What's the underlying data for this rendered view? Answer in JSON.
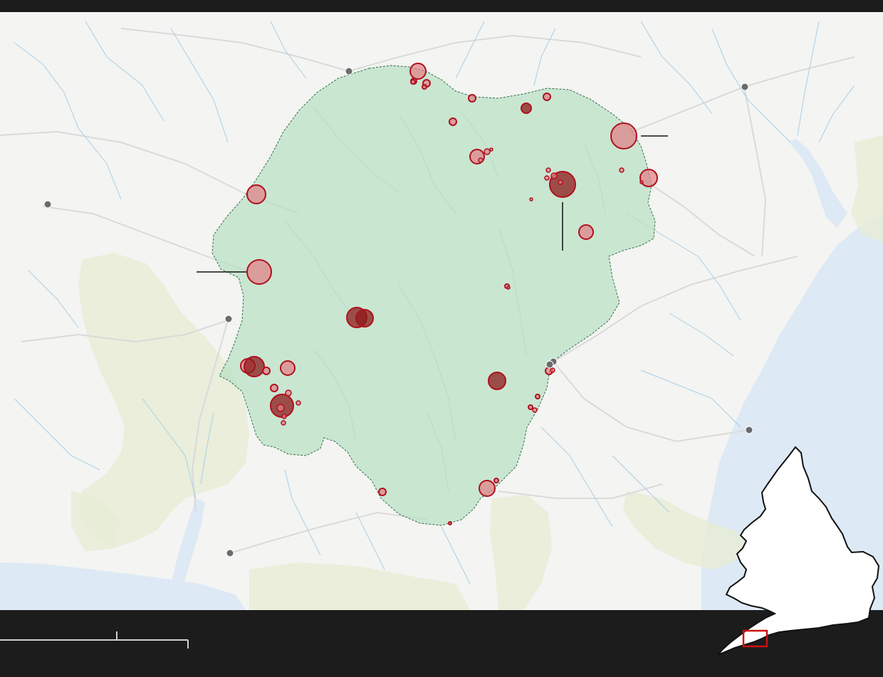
{
  "map": {
    "colors": {
      "land": "#f4f4f2",
      "sea": "#dde9f4",
      "river": "#a8cfe6",
      "road": "#dadada",
      "national_park_fill": "#b9e0c4",
      "national_park_border": "#2f6e4a",
      "aonb_fill": "#e8ecd7",
      "marker_fill_dark": "#8c1a1a",
      "marker_fill_light": "#e37e86",
      "marker_stroke": "#b0101e",
      "town_dot": "#6b6b6b",
      "frame": "#1c1c1c",
      "scale_bar": "#d0d0d0",
      "locator_land": "#ffffff",
      "locator_frame": "#cc1111"
    },
    "icons": {
      "town": "town-dot-icon",
      "site": "site-circle-marker-icon",
      "locator": "england-wales-locator-icon"
    },
    "sites": [
      {
        "id": "s01",
        "tone": "light",
        "magnitude": 3
      },
      {
        "id": "s02",
        "tone": "light",
        "magnitude": 2
      },
      {
        "id": "s03",
        "tone": "light",
        "magnitude": 1
      },
      {
        "id": "s04",
        "tone": "light",
        "magnitude": 1
      },
      {
        "id": "s05",
        "tone": "light",
        "magnitude": 1
      },
      {
        "id": "s06",
        "tone": "light",
        "magnitude": 3
      },
      {
        "id": "s07",
        "tone": "light",
        "magnitude": 2
      },
      {
        "id": "s08",
        "tone": "dark",
        "magnitude": 4
      },
      {
        "id": "s09",
        "tone": "light",
        "magnitude": 2
      },
      {
        "id": "s10",
        "tone": "light",
        "magnitude": 8
      },
      {
        "id": "s11",
        "tone": "light",
        "magnitude": 5
      },
      {
        "id": "s12",
        "tone": "dark",
        "magnitude": 9
      },
      {
        "id": "s13",
        "tone": "light",
        "magnitude": 4
      },
      {
        "id": "s14",
        "tone": "light",
        "magnitude": 5
      },
      {
        "id": "s15",
        "tone": "light",
        "magnitude": 8
      },
      {
        "id": "s16",
        "tone": "dark",
        "magnitude": 7
      },
      {
        "id": "s17",
        "tone": "dark",
        "magnitude": 6
      },
      {
        "id": "s18",
        "tone": "light",
        "magnitude": 5
      },
      {
        "id": "s19",
        "tone": "light",
        "magnitude": 5
      },
      {
        "id": "s20",
        "tone": "light",
        "magnitude": 4
      },
      {
        "id": "s21",
        "tone": "light",
        "magnitude": 2
      },
      {
        "id": "s22",
        "tone": "dark",
        "magnitude": 7
      },
      {
        "id": "s23",
        "tone": "dark",
        "magnitude": 6
      },
      {
        "id": "s24",
        "tone": "light",
        "magnitude": 2
      },
      {
        "id": "s25",
        "tone": "dark",
        "magnitude": 6
      },
      {
        "id": "s26",
        "tone": "light",
        "magnitude": 2
      },
      {
        "id": "s27",
        "tone": "light",
        "magnitude": 2
      },
      {
        "id": "s28",
        "tone": "light",
        "magnitude": 1
      },
      {
        "id": "s29",
        "tone": "light",
        "magnitude": 1
      },
      {
        "id": "s30",
        "tone": "light",
        "magnitude": 4
      },
      {
        "id": "s31",
        "tone": "light",
        "magnitude": 1
      },
      {
        "id": "s32",
        "tone": "light",
        "magnitude": 2
      },
      {
        "id": "s33",
        "tone": "light",
        "magnitude": 1
      }
    ],
    "towns": [
      "t1",
      "t2",
      "t3",
      "t4",
      "t5",
      "t6",
      "t7",
      "t8"
    ],
    "callouts": [
      "c1",
      "c2",
      "c3"
    ],
    "scale_bar": {
      "ticks": 3
    },
    "locator": {
      "region": "england-wales"
    }
  }
}
